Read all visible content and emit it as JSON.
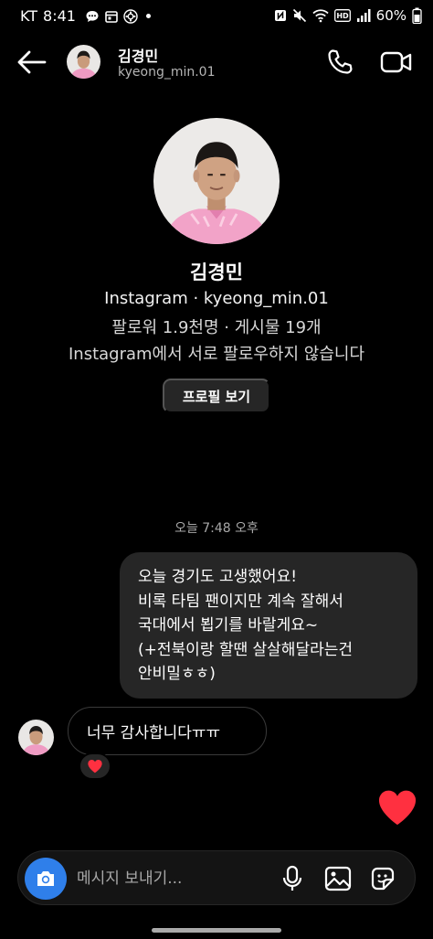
{
  "status_bar": {
    "carrier": "KT",
    "time": "8:41",
    "battery": "60%",
    "left_icons": [
      "chat-bubble-icon",
      "calendar-icon",
      "settings-app-icon",
      "dot-icon"
    ],
    "right_icons": [
      "nfc-icon",
      "mute-icon",
      "wifi-icon",
      "hd-icon",
      "signal-icon",
      "battery-icon"
    ]
  },
  "header": {
    "display_name": "김경민",
    "username": "kyeong_min.01"
  },
  "profile": {
    "name": "김경민",
    "line1": "Instagram · kyeong_min.01",
    "line2": "팔로워 1.9천명 · 게시물 19개",
    "line3": "Instagram에서 서로 팔로우하지 않습니다",
    "view_profile_label": "프로필 보기"
  },
  "conversation": {
    "timestamp": "오늘 7:48 오후",
    "sent_message_lines": [
      "오늘 경기도 고생했어요!",
      "비록 타팀 팬이지만 계속 잘해서",
      "국대에서 뵙기를 바랄게요~",
      "(+전북이랑 할땐 살살해달라는건",
      "안비밀ㅎㅎ)"
    ],
    "received_message": "너무 감사합니다ㅠㅠ",
    "reaction_emoji": "heart-icon"
  },
  "composer": {
    "placeholder": "메시지 보내기..."
  },
  "colors": {
    "background": "#000000",
    "bubble_sent": "#262626",
    "camera_button": "#2f7fea",
    "heart": "#ff3040",
    "secondary_text": "#a8a8a8"
  }
}
